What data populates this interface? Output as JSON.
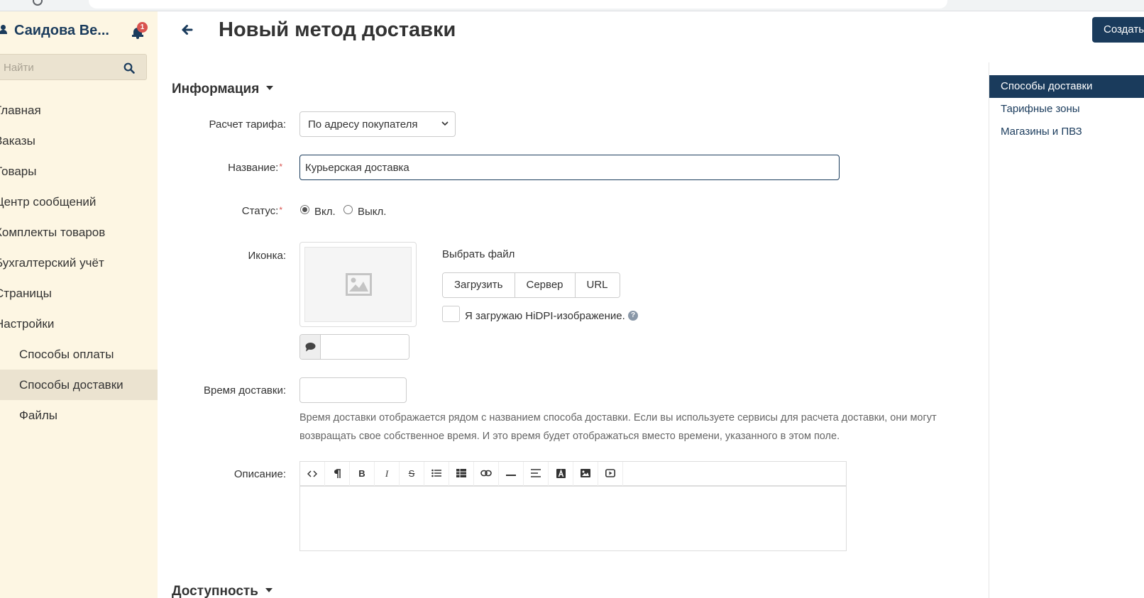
{
  "sidebar": {
    "user_name": "Саидова Ве...",
    "notifications_count": "1",
    "search_placeholder": "Найти",
    "nav": [
      {
        "label": "Главная"
      },
      {
        "label": "Заказы"
      },
      {
        "label": "Товары"
      },
      {
        "label": "Центр сообщений"
      },
      {
        "label": "Комплекты товаров"
      },
      {
        "label": "Бухгалтерский учёт"
      },
      {
        "label": "Страницы"
      },
      {
        "label": "Настройки"
      },
      {
        "label": "Способы оплаты"
      },
      {
        "label": "Способы доставки"
      },
      {
        "label": "Файлы"
      }
    ]
  },
  "header": {
    "title": "Новый метод доставки",
    "create_label": "Создать"
  },
  "right_panel": {
    "items": [
      {
        "label": "Способы доставки"
      },
      {
        "label": "Тарифные зоны"
      },
      {
        "label": "Магазины и ПВЗ"
      }
    ]
  },
  "info_section": {
    "title": "Информация",
    "rate_label": "Расчет тарифа:",
    "rate_value": "По адресу покупателя",
    "name_label": "Название:",
    "name_value": "Курьерская доставка",
    "status_label": "Статус:",
    "status_on": "Вкл.",
    "status_off": "Выкл.",
    "status_selected": "on",
    "icon_label": "Иконка:",
    "choose_file": "Выбрать файл",
    "upload_buttons": {
      "upload": "Загрузить",
      "server": "Сервер",
      "url": "URL"
    },
    "hidpi_label": "Я загружаю HiDPI-изображение.",
    "hidpi_help_glyph": "?",
    "hidpi_checked": false,
    "delivery_time_label": "Время доставки:",
    "delivery_time_value": "",
    "delivery_time_help": "Время доставки отображается рядом с названием способа доставки. Если вы используете сервисы для расчета доставки, они могут возвращать свое собственное время. И это время будет отображаться вместо времени, указанного в этом поле.",
    "description_label": "Описание:",
    "toolbar": {
      "bold": "B",
      "italic": "I",
      "strikethrough": "S"
    }
  },
  "availability_section": {
    "title": "Доступность"
  },
  "icons": {
    "user": "user-icon",
    "bell": "bell-icon",
    "search": "search-icon",
    "back": "arrow-left-icon",
    "image_placeholder": "image-placeholder-icon",
    "comment": "comment-icon",
    "help": "question-circle-icon"
  },
  "colors": {
    "brand": "#1a3b5c",
    "sidebar_bg": "#fdf6e3",
    "sidebar_active": "#ebe3d0",
    "badge": "#d9534f"
  }
}
